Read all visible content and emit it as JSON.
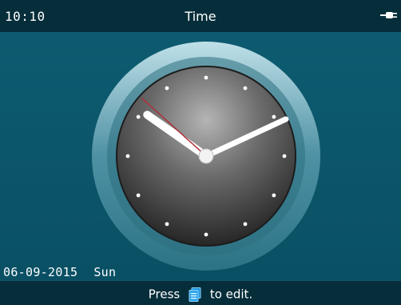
{
  "status_bar": {
    "time": "10:10",
    "title": "Time",
    "icon": "plug-icon"
  },
  "clock": {
    "hour": 10,
    "minute": 10,
    "second": 52,
    "face_color": "#4a4a4a",
    "rim_color": "#7fb4c3",
    "hand_color": "#ffffff",
    "second_hand_color": "#b0313a"
  },
  "date": {
    "date_text": "06-09-2015",
    "day_text": "Sun"
  },
  "footer": {
    "press_text": "Press",
    "icon": "menu-key-icon",
    "edit_text": "to edit."
  }
}
